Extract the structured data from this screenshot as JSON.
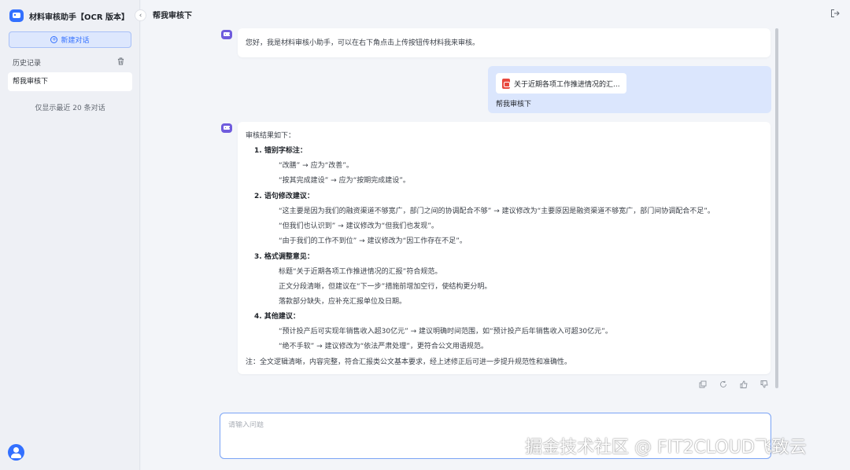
{
  "sidebar": {
    "app_title": "材料审核助手【OCR 版本】",
    "new_chat_label": "新建对话",
    "history_label": "历史记录",
    "history_items": [
      "帮我审核下"
    ],
    "history_note": "仅显示最近 20 条对话"
  },
  "main": {
    "chat_title": "帮我审核下",
    "greeting": "您好，我是材料审核小助手，可以在右下角点击上传按钮传材料我来审核。",
    "user_file_name": "关于近期各项工作推进情况的汇...",
    "user_message": "帮我审核下",
    "result": {
      "intro": "审核结果如下：",
      "sections": [
        {
          "title": "1. 错别字标注：",
          "items": [
            "“改膳” → 应为“改善”。",
            "“按其完成建设” → 应为“按期完成建设”。"
          ]
        },
        {
          "title": "2. 语句修改建议：",
          "items": [
            "“这主要是因为我们的融资渠道不够宽广，部门之间的协调配合不够” → 建议修改为“主要原因是融资渠道不够宽广，部门间协调配合不足”。",
            "“但我们也认识到” → 建议修改为“但我们也发现”。",
            "“由于我们的工作不到位” → 建议修改为“因工作存在不足”。"
          ]
        },
        {
          "title": "3. 格式调整意见：",
          "items": [
            "标题“关于近期各项工作推进情况的汇报”符合规范。",
            "正文分段清晰，但建议在“下一步”措施前增加空行，使结构更分明。",
            "落款部分缺失，应补充汇报单位及日期。"
          ]
        },
        {
          "title": "4. 其他建议：",
          "items": [
            "“预计投产后可实现年销售收入超30亿元” → 建议明确时间范围，如“预计投产后年销售收入可超30亿元”。",
            "“绝不手软” → 建议修改为“依法严肃处理”，更符合公文用语规范。"
          ]
        }
      ],
      "note": "注：全文逻辑清晰，内容完整，符合汇报类公文基本要求，经上述修正后可进一步提升规范性和准确性。"
    },
    "input_placeholder": "请输入问题"
  },
  "watermark": "掘金技术社区 @ FIT2CLOUD飞致云",
  "icons": [
    "app-logo-icon",
    "chevron-left-icon",
    "plus-circle-icon",
    "trash-icon",
    "export-icon",
    "bot-icon",
    "pdf-icon",
    "copy-icon",
    "refresh-icon",
    "thumbs-up-icon",
    "thumbs-down-icon",
    "user-avatar-icon"
  ],
  "colors": {
    "accent": "#3370ff",
    "bot": "#6f5bdd",
    "user_bubble": "#dbe6fd",
    "pdf": "#e8493f"
  }
}
